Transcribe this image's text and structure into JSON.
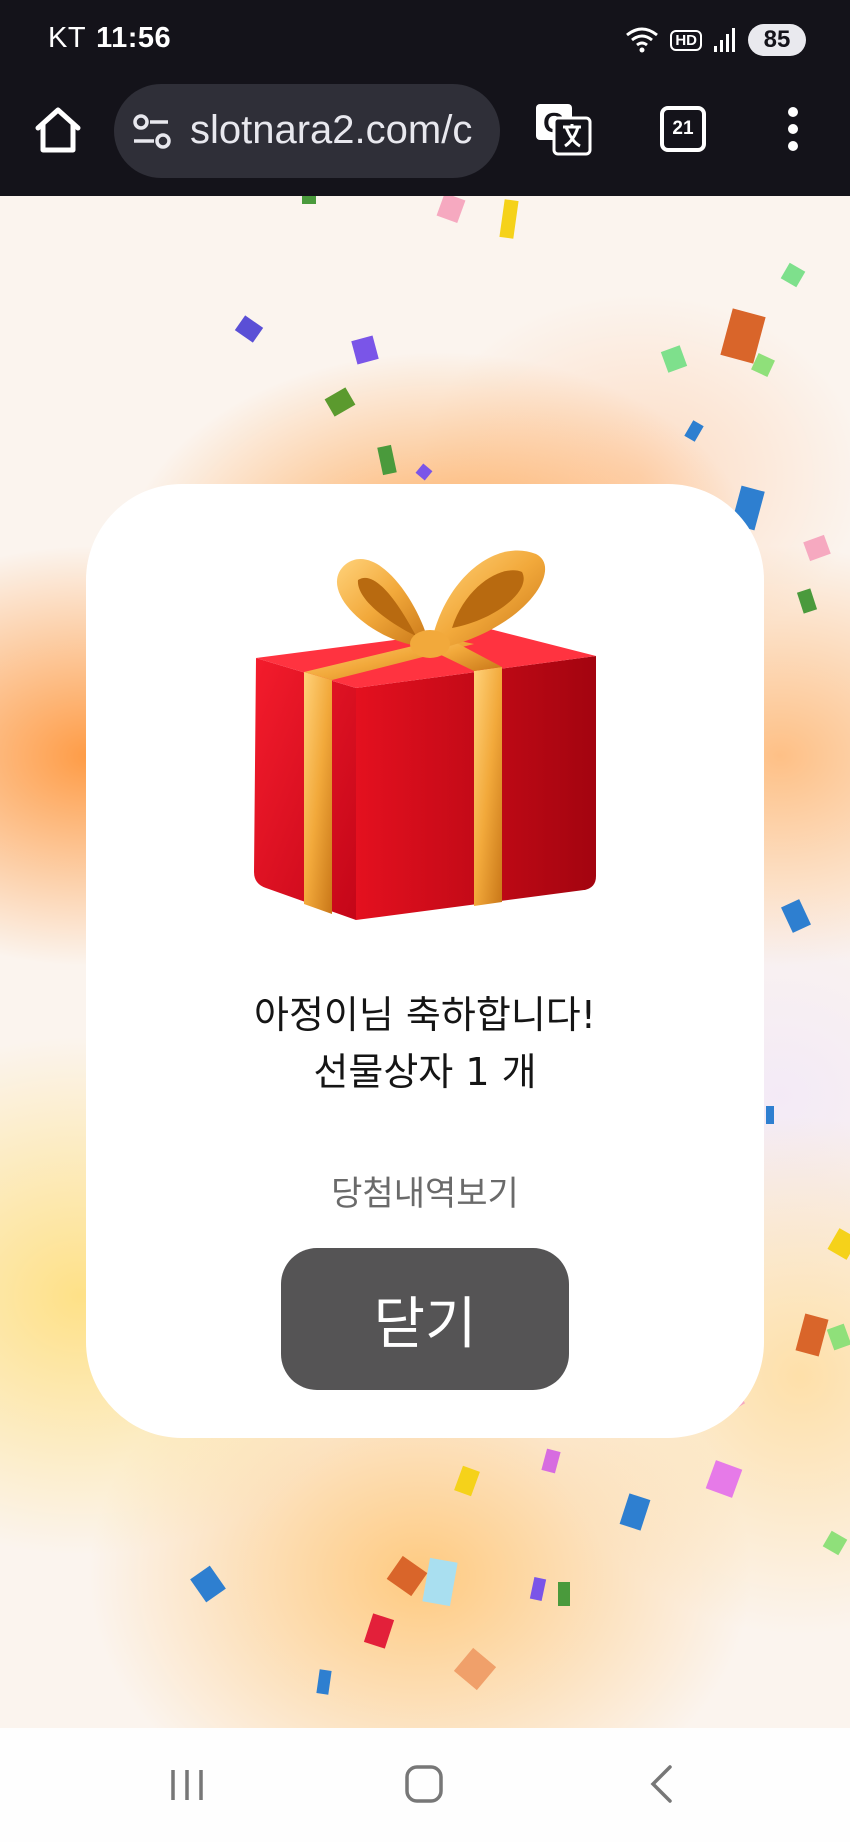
{
  "status_bar": {
    "carrier": "KT",
    "time": "11:56",
    "hd_badge": "HD",
    "battery": "85"
  },
  "browser": {
    "url": "slotnara2.com/c",
    "tab_count": "21",
    "icons": [
      "home-icon",
      "site-settings-icon",
      "translate-icon",
      "tabs-icon",
      "more-vert-icon"
    ]
  },
  "dialog": {
    "message_line1": "아정이님 축하합니다!",
    "message_line2": "선물상자 1 개",
    "history_link": "당첨내역보기",
    "close_label": "닫기",
    "gift_icon": "gift-box-icon"
  },
  "colors": {
    "gift_red": "#e3101f",
    "ribbon_gold": "#f2a93b",
    "close_button": "#555455",
    "browser_bar": "#14131a"
  }
}
